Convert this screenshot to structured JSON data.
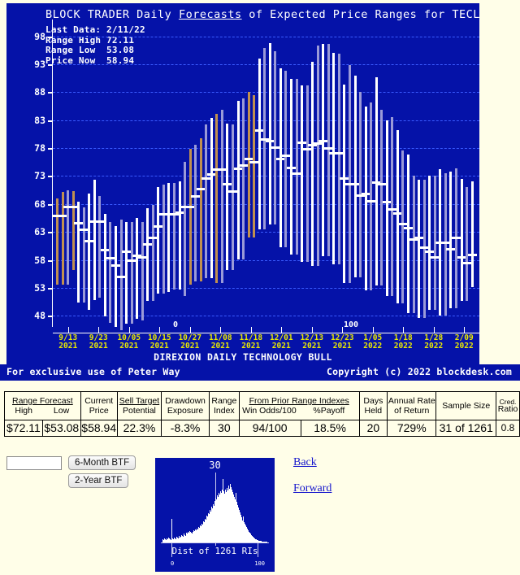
{
  "chart": {
    "title_parts": [
      "BLOCK TRADER Daily ",
      "Forecasts",
      " of Expected Price Ranges for  TECL"
    ],
    "title_plain": "BLOCK TRADER Daily Forecasts of Expected Price Ranges for  TECL",
    "info_box": "Last Data: 2/11/22\nRange High 72.11\nRange Low  53.08\nPrice Now  58.94",
    "subtitle": "DIREXION DAILY TECHNOLOGY BULL",
    "ri_low_label": "0",
    "ri_high_label": "100"
  },
  "footer": {
    "left": "For exclusive use of Peter Way",
    "right": "Copyright (c) 2022 blockdesk.com"
  },
  "chart_data": {
    "type": "bar",
    "title": "BLOCK TRADER Daily Forecasts of Expected Price Ranges for TECL",
    "subtitle": "DIREXION DAILY TECHNOLOGY BULL",
    "xlabel": "",
    "ylabel": "Price",
    "ylim": [
      46,
      101
    ],
    "yticks": [
      48,
      53,
      58,
      63,
      68,
      73,
      78,
      83,
      88,
      93,
      98
    ],
    "grid": true,
    "legend": null,
    "xticklabels": [
      "9/13\n2021",
      "9/23\n2021",
      "10/05\n2021",
      "10/15\n2021",
      "10/27\n2021",
      "11/08\n2021",
      "11/18\n2021",
      "12/01\n2021",
      "12/13\n2021",
      "12/23\n2021",
      "1/05\n2022",
      "1/18\n2022",
      "1/28\n2022",
      "2/09\n2022"
    ],
    "series_note": "Each vertical bar = forecast price range [low, high] with a white tick at the current price. Bar colors: white, lavender, tan.",
    "bars": [
      {
        "low": 53.6,
        "high": 69.0,
        "now": 65.8,
        "color": "tan"
      },
      {
        "low": 53.6,
        "high": 70.2,
        "now": 65.8,
        "color": "tan"
      },
      {
        "low": 53.6,
        "high": 70.4,
        "now": 67.4,
        "color": "lavender"
      },
      {
        "low": 56.2,
        "high": 70.3,
        "now": 67.4,
        "color": "tan"
      },
      {
        "low": 50.3,
        "high": 68.4,
        "now": 64.6,
        "color": "white"
      },
      {
        "low": 50.3,
        "high": 67.4,
        "now": 63.4,
        "color": "lavender"
      },
      {
        "low": 49.1,
        "high": 69.8,
        "now": 61.3,
        "color": "white"
      },
      {
        "low": 50.8,
        "high": 72.3,
        "now": 64.9,
        "color": "white"
      },
      {
        "low": 51.3,
        "high": 69.4,
        "now": 64.9,
        "color": "lavender"
      },
      {
        "low": 47.9,
        "high": 66.2,
        "now": 59.7,
        "color": "white"
      },
      {
        "low": 46.7,
        "high": 64.8,
        "now": 58.3,
        "color": "lavender"
      },
      {
        "low": 46.0,
        "high": 64.1,
        "now": 57.0,
        "color": "white"
      },
      {
        "low": 45.4,
        "high": 65.2,
        "now": 54.9,
        "color": "lavender"
      },
      {
        "low": 46.6,
        "high": 64.8,
        "now": 59.4,
        "color": "white"
      },
      {
        "low": 46.6,
        "high": 64.8,
        "now": 57.8,
        "color": "lavender"
      },
      {
        "low": 47.5,
        "high": 65.5,
        "now": 58.8,
        "color": "white"
      },
      {
        "low": 47.1,
        "high": 64.7,
        "now": 58.4,
        "color": "lavender"
      },
      {
        "low": 50.6,
        "high": 67.2,
        "now": 60.8,
        "color": "white"
      },
      {
        "low": 50.6,
        "high": 67.8,
        "now": 62.0,
        "color": "lavender"
      },
      {
        "low": 52.0,
        "high": 71.0,
        "now": 64.0,
        "color": "white"
      },
      {
        "low": 52.0,
        "high": 71.4,
        "now": 66.1,
        "color": "lavender"
      },
      {
        "low": 52.3,
        "high": 71.8,
        "now": 66.2,
        "color": "white"
      },
      {
        "low": 52.7,
        "high": 71.7,
        "now": 66.2,
        "color": "lavender"
      },
      {
        "low": 52.7,
        "high": 72.0,
        "now": 66.5,
        "color": "white"
      },
      {
        "low": 51.6,
        "high": 75.5,
        "now": 67.5,
        "color": "lavender"
      },
      {
        "low": 53.6,
        "high": 77.9,
        "now": 67.5,
        "color": "tan"
      },
      {
        "low": 54.1,
        "high": 78.6,
        "now": 69.4,
        "color": "lavender"
      },
      {
        "low": 54.1,
        "high": 79.7,
        "now": 70.7,
        "color": "tan"
      },
      {
        "low": 54.7,
        "high": 82.2,
        "now": 72.5,
        "color": "lavender"
      },
      {
        "low": 54.7,
        "high": 83.4,
        "now": 73.3,
        "color": "white"
      },
      {
        "low": 53.9,
        "high": 84.1,
        "now": 74.1,
        "color": "tan"
      },
      {
        "low": 53.9,
        "high": 84.8,
        "now": 74.1,
        "color": "lavender"
      },
      {
        "low": 56.2,
        "high": 82.4,
        "now": 71.6,
        "color": "white"
      },
      {
        "low": 56.2,
        "high": 82.3,
        "now": 70.2,
        "color": "lavender"
      },
      {
        "low": 58.1,
        "high": 86.4,
        "now": 74.3,
        "color": "white"
      },
      {
        "low": 58.1,
        "high": 86.9,
        "now": 74.9,
        "color": "lavender"
      },
      {
        "low": 62.0,
        "high": 88.0,
        "now": 76.1,
        "color": "tan"
      },
      {
        "low": 62.0,
        "high": 87.4,
        "now": 75.5,
        "color": "tan"
      },
      {
        "low": 63.4,
        "high": 94.0,
        "now": 81.2,
        "color": "white"
      },
      {
        "low": 63.4,
        "high": 95.9,
        "now": 79.5,
        "color": "lavender"
      },
      {
        "low": 64.3,
        "high": 96.8,
        "now": 79.3,
        "color": "white"
      },
      {
        "low": 64.3,
        "high": 95.3,
        "now": 78.1,
        "color": "lavender"
      },
      {
        "low": 60.2,
        "high": 92.2,
        "now": 76.1,
        "color": "white"
      },
      {
        "low": 60.2,
        "high": 91.9,
        "now": 76.7,
        "color": "lavender"
      },
      {
        "low": 58.9,
        "high": 90.4,
        "now": 74.5,
        "color": "white"
      },
      {
        "low": 58.9,
        "high": 90.4,
        "now": 73.5,
        "color": "lavender"
      },
      {
        "low": 57.6,
        "high": 89.2,
        "now": 78.9,
        "color": "white"
      },
      {
        "low": 57.6,
        "high": 89.2,
        "now": 77.8,
        "color": "lavender"
      },
      {
        "low": 56.9,
        "high": 93.5,
        "now": 78.5,
        "color": "white"
      },
      {
        "low": 56.9,
        "high": 96.3,
        "now": 78.8,
        "color": "lavender"
      },
      {
        "low": 58.6,
        "high": 96.7,
        "now": 79.3,
        "color": "white"
      },
      {
        "low": 58.6,
        "high": 96.6,
        "now": 78.0,
        "color": "lavender"
      },
      {
        "low": 57.2,
        "high": 95.0,
        "now": 77.0,
        "color": "white"
      },
      {
        "low": 57.2,
        "high": 94.9,
        "now": 77.0,
        "color": "lavender"
      },
      {
        "low": 53.9,
        "high": 89.3,
        "now": 72.5,
        "color": "white"
      },
      {
        "low": 53.9,
        "high": 92.9,
        "now": 71.5,
        "color": "lavender"
      },
      {
        "low": 54.9,
        "high": 91.0,
        "now": 71.5,
        "color": "white"
      },
      {
        "low": 54.9,
        "high": 88.1,
        "now": 69.5,
        "color": "lavender"
      },
      {
        "low": 52.6,
        "high": 85.5,
        "now": 69.8,
        "color": "white"
      },
      {
        "low": 52.6,
        "high": 86.1,
        "now": 68.5,
        "color": "lavender"
      },
      {
        "low": 53.4,
        "high": 90.7,
        "now": 71.8,
        "color": "white"
      },
      {
        "low": 53.4,
        "high": 84.8,
        "now": 71.5,
        "color": "lavender"
      },
      {
        "low": 51.6,
        "high": 82.9,
        "now": 68.3,
        "color": "white"
      },
      {
        "low": 51.6,
        "high": 83.6,
        "now": 67.0,
        "color": "lavender"
      },
      {
        "low": 50.2,
        "high": 81.2,
        "now": 66.3,
        "color": "white"
      },
      {
        "low": 50.2,
        "high": 77.6,
        "now": 64.4,
        "color": "lavender"
      },
      {
        "low": 48.4,
        "high": 76.8,
        "now": 63.7,
        "color": "white"
      },
      {
        "low": 48.4,
        "high": 73.0,
        "now": 61.7,
        "color": "lavender"
      },
      {
        "low": 47.6,
        "high": 72.4,
        "now": 61.9,
        "color": "white"
      },
      {
        "low": 47.6,
        "high": 72.4,
        "now": 60.2,
        "color": "lavender"
      },
      {
        "low": 49.0,
        "high": 73.0,
        "now": 59.5,
        "color": "white"
      },
      {
        "low": 49.0,
        "high": 73.0,
        "now": 58.5,
        "color": "lavender"
      },
      {
        "low": 48.1,
        "high": 74.3,
        "now": 61.1,
        "color": "white"
      },
      {
        "low": 48.1,
        "high": 73.5,
        "now": 61.1,
        "color": "lavender"
      },
      {
        "low": 49.4,
        "high": 73.8,
        "now": 59.9,
        "color": "white"
      },
      {
        "low": 49.4,
        "high": 74.4,
        "now": 61.9,
        "color": "lavender"
      },
      {
        "low": 50.6,
        "high": 72.5,
        "now": 58.5,
        "color": "white"
      },
      {
        "low": 50.6,
        "high": 71.0,
        "now": 57.4,
        "color": "lavender"
      },
      {
        "low": 53.1,
        "high": 72.1,
        "now": 58.9,
        "color": "white"
      }
    ]
  },
  "table": {
    "headers": [
      {
        "top": "Range Forecast",
        "top_underlined": true,
        "subs": [
          "High",
          "Low"
        ],
        "span": 2
      },
      {
        "top": "Current",
        "top_underlined": false,
        "subs": [
          "Price"
        ],
        "span": 1
      },
      {
        "top": "Sell Target",
        "top_underlined": true,
        "subs": [
          "Potential"
        ],
        "span": 1
      },
      {
        "top": "Drawdown",
        "top_underlined": false,
        "subs": [
          "Exposure"
        ],
        "span": 1
      },
      {
        "top": "Range",
        "top_underlined": false,
        "subs": [
          "Index"
        ],
        "span": 1
      },
      {
        "top": "From Prior Range Indexes",
        "top_underlined": true,
        "subs": [
          "Win Odds/100",
          "%Payoff"
        ],
        "span": 2
      },
      {
        "top": "Days",
        "top_underlined": false,
        "subs": [
          "Held"
        ],
        "span": 1
      },
      {
        "top": "Annual Rate",
        "top_underlined": false,
        "subs": [
          "of Return"
        ],
        "span": 1
      },
      {
        "top": "Sample Size",
        "top_underlined": false,
        "subs": [],
        "span": 1
      },
      {
        "top": "Cred.",
        "top_underlined": false,
        "subs": [
          "Ratio"
        ],
        "span": 1,
        "small": true
      }
    ],
    "row": [
      "$72.11",
      "$53.08",
      "$58.94",
      "22.3%",
      "-8.3%",
      "30",
      "94/100",
      "18.5%",
      "20",
      "729%",
      "31 of 1261",
      "0.8"
    ]
  },
  "controls": {
    "ticker_value": "",
    "ticker_placeholder": "",
    "btn_6month": "6-Month BTF",
    "btn_2year": "2-Year BTF",
    "link_back": "Back",
    "link_forward": "Forward"
  },
  "histogram": {
    "value_label": "30",
    "caption": "Dist of 1261 RIs",
    "x_min": "0",
    "x_max": "100",
    "bin_heights": [
      4,
      3,
      5,
      4,
      3,
      5,
      4,
      6,
      5,
      4,
      3,
      28,
      5,
      4,
      6,
      5,
      4,
      7,
      6,
      5,
      8,
      6,
      7,
      9,
      8,
      7,
      10,
      9,
      8,
      11,
      10,
      12,
      11,
      13,
      12,
      11,
      10,
      12,
      14,
      13,
      15,
      14,
      16,
      15,
      18,
      17,
      20,
      19,
      22,
      21,
      25,
      24,
      28,
      27,
      31,
      30,
      34,
      33,
      38,
      36,
      42,
      40,
      45,
      43,
      48,
      52,
      50,
      55,
      53,
      58,
      56,
      60,
      58,
      62,
      74,
      60,
      57,
      62,
      59,
      64,
      61,
      66,
      63,
      68,
      65,
      62,
      59,
      56,
      53,
      50,
      58,
      47,
      44,
      41,
      38,
      35,
      32,
      29,
      26,
      30,
      24,
      22,
      20,
      18,
      16,
      14,
      12,
      11,
      10,
      9,
      8,
      7,
      6,
      5,
      4,
      4,
      3,
      3,
      2,
      2,
      2,
      2,
      1,
      1,
      1,
      1,
      1,
      1,
      1
    ]
  },
  "colors": {
    "panel_bg": "#0512a8",
    "page_bg": "#fffee8",
    "grid": "#3a5bff",
    "axis_label": "#eaea00",
    "bar_white": "#ffffff",
    "bar_lavender": "#9a9ad8",
    "bar_tan": "#c09050",
    "link": "#1414cc"
  }
}
